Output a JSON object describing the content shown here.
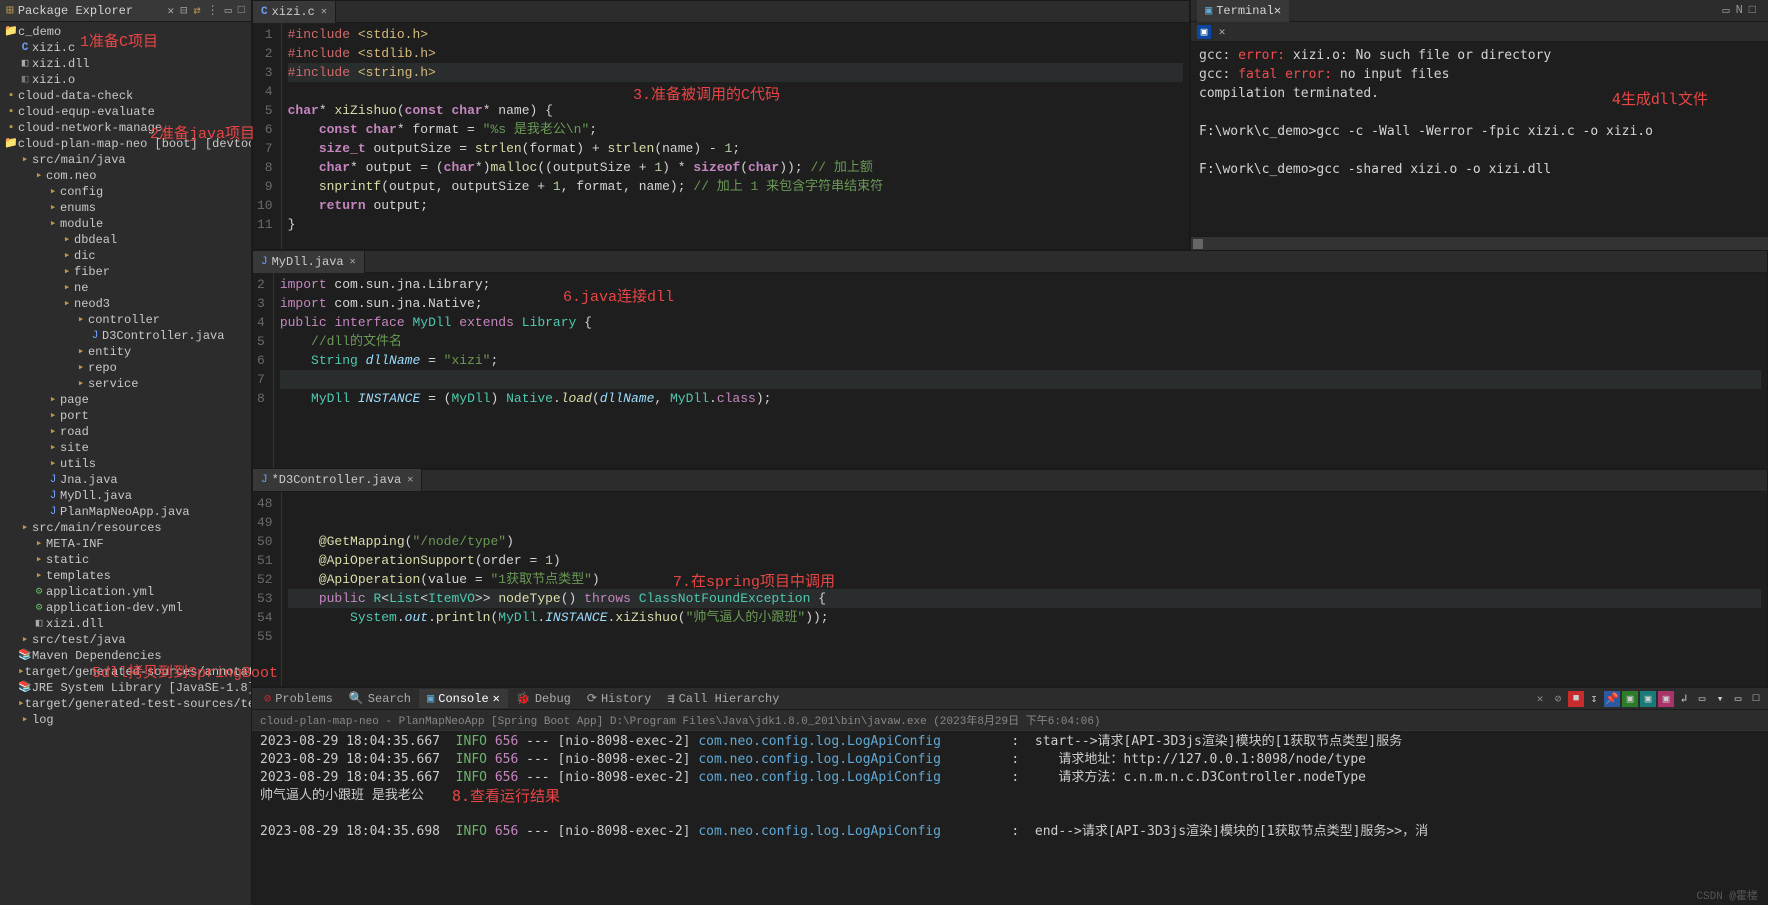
{
  "sidebar": {
    "title": "Package Explorer",
    "tree": [
      {
        "indent": 0,
        "icon": "📁",
        "cls": "col-folder",
        "label": "c_demo"
      },
      {
        "indent": 1,
        "icon": "C",
        "cls": "col-file-c",
        "label": "xizi.c"
      },
      {
        "indent": 1,
        "icon": "◧",
        "cls": "col-dll",
        "label": "xizi.dll"
      },
      {
        "indent": 1,
        "icon": "◧",
        "cls": "col-file-o",
        "label": "xizi.o"
      },
      {
        "indent": 0,
        "icon": "▪",
        "cls": "col-folder",
        "label": "cloud-data-check"
      },
      {
        "indent": 0,
        "icon": "▪",
        "cls": "col-folder",
        "label": "cloud-equp-evaluate"
      },
      {
        "indent": 0,
        "icon": "▪",
        "cls": "col-folder",
        "label": "cloud-network-manage"
      },
      {
        "indent": 0,
        "icon": "📁",
        "cls": "col-folder",
        "label": "cloud-plan-map-neo [boot] [devtools]"
      },
      {
        "indent": 1,
        "icon": "▸",
        "cls": "col-pkg",
        "label": "src/main/java"
      },
      {
        "indent": 2,
        "icon": "▸",
        "cls": "col-pkg",
        "label": "com.neo"
      },
      {
        "indent": 3,
        "icon": "▸",
        "cls": "col-pkg",
        "label": "config"
      },
      {
        "indent": 3,
        "icon": "▸",
        "cls": "col-pkg",
        "label": "enums"
      },
      {
        "indent": 3,
        "icon": "▸",
        "cls": "col-pkg",
        "label": "module"
      },
      {
        "indent": 4,
        "icon": "▸",
        "cls": "col-pkg",
        "label": "dbdeal"
      },
      {
        "indent": 4,
        "icon": "▸",
        "cls": "col-pkg",
        "label": "dic"
      },
      {
        "indent": 4,
        "icon": "▸",
        "cls": "col-pkg",
        "label": "fiber"
      },
      {
        "indent": 4,
        "icon": "▸",
        "cls": "col-pkg",
        "label": "ne"
      },
      {
        "indent": 4,
        "icon": "▸",
        "cls": "col-pkg",
        "label": "neod3"
      },
      {
        "indent": 5,
        "icon": "▸",
        "cls": "col-pkg",
        "label": "controller"
      },
      {
        "indent": 6,
        "icon": "J",
        "cls": "col-file-java",
        "label": "D3Controller.java"
      },
      {
        "indent": 5,
        "icon": "▸",
        "cls": "col-pkg",
        "label": "entity"
      },
      {
        "indent": 5,
        "icon": "▸",
        "cls": "col-pkg",
        "label": "repo"
      },
      {
        "indent": 5,
        "icon": "▸",
        "cls": "col-pkg",
        "label": "service"
      },
      {
        "indent": 3,
        "icon": "▸",
        "cls": "col-pkg",
        "label": "page"
      },
      {
        "indent": 3,
        "icon": "▸",
        "cls": "col-pkg",
        "label": "port"
      },
      {
        "indent": 3,
        "icon": "▸",
        "cls": "col-pkg",
        "label": "road"
      },
      {
        "indent": 3,
        "icon": "▸",
        "cls": "col-pkg",
        "label": "site"
      },
      {
        "indent": 3,
        "icon": "▸",
        "cls": "col-pkg",
        "label": "utils"
      },
      {
        "indent": 3,
        "icon": "J",
        "cls": "col-file-j",
        "label": "Jna.java"
      },
      {
        "indent": 3,
        "icon": "J",
        "cls": "col-file-j",
        "label": "MyDll.java"
      },
      {
        "indent": 3,
        "icon": "J",
        "cls": "col-file-j",
        "label": "PlanMapNeoApp.java"
      },
      {
        "indent": 1,
        "icon": "▸",
        "cls": "col-pkg",
        "label": "src/main/resources"
      },
      {
        "indent": 2,
        "icon": "▸",
        "cls": "col-pkg",
        "label": "META-INF"
      },
      {
        "indent": 2,
        "icon": "▸",
        "cls": "col-pkg",
        "label": "static"
      },
      {
        "indent": 2,
        "icon": "▸",
        "cls": "col-pkg",
        "label": "templates"
      },
      {
        "indent": 2,
        "icon": "⚙",
        "cls": "col-yml",
        "label": "application.yml"
      },
      {
        "indent": 2,
        "icon": "⚙",
        "cls": "col-yml",
        "label": "application-dev.yml"
      },
      {
        "indent": 2,
        "icon": "◧",
        "cls": "col-dll",
        "label": "xizi.dll"
      },
      {
        "indent": 1,
        "icon": "▸",
        "cls": "col-pkg",
        "label": "src/test/java"
      },
      {
        "indent": 1,
        "icon": "📚",
        "cls": "col-folder",
        "label": "Maven Dependencies"
      },
      {
        "indent": 1,
        "icon": "▸",
        "cls": "col-pkg",
        "label": "target/generated-sources/annotations"
      },
      {
        "indent": 1,
        "icon": "📚",
        "cls": "col-folder",
        "label": "JRE System Library [JavaSE-1.8]"
      },
      {
        "indent": 1,
        "icon": "▸",
        "cls": "col-pkg",
        "label": "target/generated-test-sources/test-anno"
      },
      {
        "indent": 1,
        "icon": "▸",
        "cls": "col-pkg",
        "label": "log"
      }
    ]
  },
  "annotations": {
    "a1": "1准备C项目",
    "a2": "2准备java项目",
    "a3": "3.准备被调用的C代码",
    "a4": "4生成dll文件",
    "a5": "5dll拷贝到到SpringBoot",
    "a6": "6.java连接dll",
    "a7": "7.在spring项目中调用",
    "a8": "8.查看运行结果"
  },
  "editor1": {
    "tab": "xizi.c",
    "startLine": 1,
    "lines": [
      "<span class='k-include'>#include</span> <span class='k-brackets'>&lt;stdio.h&gt;</span>",
      "<span class='k-include'>#include</span> <span class='k-brackets'>&lt;stdlib.h&gt;</span>",
      "<span class='k-include'>#include</span> <span class='k-brackets'>&lt;string.h&gt;</span>",
      "",
      "<span class='k-kw2'>char</span>* <span class='k-func'>xiZishuo</span>(<span class='k-kw2'>const char</span>* name) {",
      "    <span class='k-kw2'>const char</span>* format = <span class='k-string'>\"%s 是我老公\\n\"</span>;",
      "    <span class='k-kw2'>size_t</span> outputSize = <span class='k-func'>strlen</span>(format) + <span class='k-func'>strlen</span>(name) - <span class='k-num'>1</span>;",
      "    <span class='k-kw2'>char</span>* output = (<span class='k-kw2'>char</span>*)<span class='k-func'>malloc</span>((outputSize + <span class='k-num'>1</span>) * <span class='k-kw2'>sizeof</span>(<span class='k-kw2'>char</span>)); <span class='k-comment'>// 加上额</span>",
      "    <span class='k-func'>snprintf</span>(output, outputSize + <span class='k-num'>1</span>, format, name); <span class='k-comment'>// 加上 1 来包含字符串结束符</span>",
      "    <span class='k-kw2'>return</span> output;",
      "}"
    ]
  },
  "terminal": {
    "tab": "Terminal",
    "lines": [
      "<span class='t-gcc'>gcc:</span> <span class='t-red'>error:</span> xizi.o: No such file or directory",
      "<span class='t-gcc'>gcc:</span> <span class='t-red'>fatal error:</span> no input files",
      "compilation terminated.",
      "",
      "F:\\work\\c_demo>gcc -c -Wall -Werror -fpic xizi.c -o xizi.o",
      "",
      "F:\\work\\c_demo>gcc -shared xizi.o -o xizi.dll",
      ""
    ]
  },
  "editor2": {
    "tab": "MyDll.java",
    "startLine": 2,
    "lines": [
      "<span class='k-import'>import</span> com.sun.jna.Library;",
      "<span class='k-import'>import</span> com.sun.jna.Native;",
      "<span class='k-import'>public</span> <span class='k-import'>interface</span> <span class='k-class'>MyDll</span> <span class='k-import'>extends</span> <span class='k-class'>Library</span> {",
      "    <span class='k-comment'>//dll的文件名</span>",
      "    <span class='k-class'>String</span> <span class='k-var'>dllName</span> = <span class='k-string'>\"xizi\"</span>;",
      "",
      "    <span class='k-class'>MyDll</span> <span class='k-var'>INSTANCE</span> = (<span class='k-class'>MyDll</span>) <span class='k-class'>Native</span>.<span class='k-func k-ital'>load</span>(<span class='k-var'>dllName</span>, <span class='k-class'>MyDll</span>.<span class='k-import'>class</span>);"
    ]
  },
  "editor3": {
    "tab": "*D3Controller.java",
    "startLine": 48,
    "lines": [
      "",
      "",
      "    <span class='k-ann'>@GetMapping</span>(<span class='k-string'>\"/node/type\"</span>)",
      "    <span class='k-ann'>@ApiOperationSupport</span>(order = <span class='k-num'>1</span>)",
      "    <span class='k-ann'>@ApiOperation</span>(value = <span class='k-string'>\"1获取节点类型\"</span>)",
      "    <span class='k-import'>public</span> <span class='k-class'>R</span>&lt;<span class='k-class'>List</span>&lt;<span class='k-class'>ItemVO</span>&gt;&gt; <span class='k-func'>nodeType</span>() <span class='k-import'>throws</span> <span class='k-class'>ClassNotFoundException</span> {",
      "        <span class='k-class'>System</span>.<span class='k-var'>out</span>.<span class='k-func'>println</span>(<span class='k-class'>MyDll</span>.<span class='k-var'>INSTANCE</span>.<span class='k-func'>xiZishuo</span>(<span class='k-string'>\"帅气逼人的小跟班\"</span>));",
      ""
    ]
  },
  "console": {
    "context": "cloud-plan-map-neo - PlanMapNeoApp [Spring Boot App] D:\\Program Files\\Java\\jdk1.8.0_201\\bin\\javaw.exe  (2023年8月29日 下午6:04:06)",
    "tabs": [
      "Problems",
      "Search",
      "Console",
      "Debug",
      "History",
      "Call Hierarchy"
    ],
    "lines": [
      {
        "ts": "2023-08-29 18:04:35.667",
        "lvl": "INFO",
        "pid": "656",
        "thr": "[nio-8098-exec-2]",
        "cls": "com.neo.config.log.LogApiConfig",
        "msg": ":  start-->请求[API-3D3js渲染]模块的[1获取节点类型]服务"
      },
      {
        "ts": "2023-08-29 18:04:35.667",
        "lvl": "INFO",
        "pid": "656",
        "thr": "[nio-8098-exec-2]",
        "cls": "com.neo.config.log.LogApiConfig",
        "msg": ":     请求地址：http://127.0.0.1:8098/node/type"
      },
      {
        "ts": "2023-08-29 18:04:35.667",
        "lvl": "INFO",
        "pid": "656",
        "thr": "[nio-8098-exec-2]",
        "cls": "com.neo.config.log.LogApiConfig",
        "msg": ":     请求方法：c.n.m.n.c.D3Controller.nodeType"
      },
      {
        "ts": "",
        "lvl": "",
        "pid": "",
        "thr": "",
        "cls": "",
        "msg": "帅气逼人的小跟班 是我老公"
      },
      {
        "ts": "",
        "lvl": "",
        "pid": "",
        "thr": "",
        "cls": "",
        "msg": ""
      },
      {
        "ts": "2023-08-29 18:04:35.698",
        "lvl": "INFO",
        "pid": "656",
        "thr": "[nio-8098-exec-2]",
        "cls": "com.neo.config.log.LogApiConfig",
        "msg": ":  end-->请求[API-3D3js渲染]模块的[1获取节点类型]服务>>，消"
      }
    ]
  },
  "watermark": "CSDN @霍楼"
}
